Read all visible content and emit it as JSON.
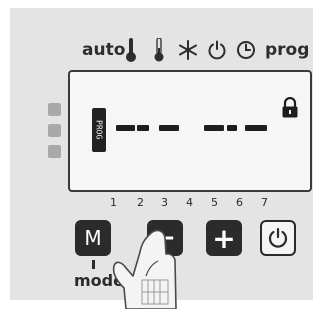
{
  "header": {
    "auto_label": "auto",
    "prog_label": "prog",
    "icons": [
      "thermometer-full-icon",
      "thermometer-low-icon",
      "snowflake-icon",
      "power-icon",
      "clock-icon"
    ]
  },
  "display": {
    "prog_badge": "PROG",
    "segments": [
      "-",
      "-",
      "-",
      "-",
      "-",
      "-",
      "-"
    ],
    "lock_icon": "padlock-icon"
  },
  "indicator_leds": 3,
  "day_numbers": [
    "1",
    "2",
    "3",
    "4",
    "5",
    "6",
    "7"
  ],
  "buttons": {
    "mode": "M",
    "minus": "−",
    "plus": "+",
    "power": "power-icon"
  },
  "mode_label": "mode",
  "colors": {
    "panel": "#e4e4e4",
    "button_dark": "#2b2b2b",
    "lcd": "#f6f6f6"
  }
}
